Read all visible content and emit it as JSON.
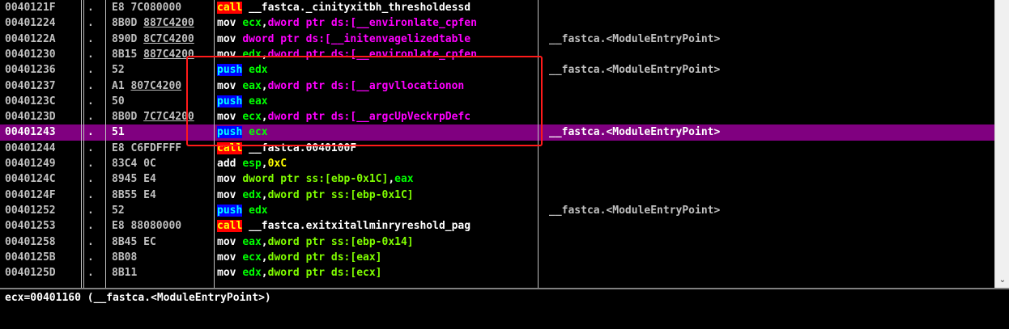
{
  "rows": [
    {
      "addr": "0040121F",
      "mark": ".",
      "hex": "E8 7C080000",
      "hex_ul": "",
      "hex_rest": "",
      "asm": [
        {
          "t": "call",
          "c": "t-call"
        },
        {
          "t": " "
        },
        {
          "t": "__fastca._cinityxitbh_thresholdessd",
          "c": "t-plain"
        }
      ],
      "comment": ""
    },
    {
      "addr": "00401224",
      "mark": ".",
      "hex": "",
      "hex_pre": "8B0D ",
      "hex_ul": "887C4200",
      "asm": [
        {
          "t": "mov",
          "c": "t-mov"
        },
        {
          "t": " "
        },
        {
          "t": "ecx",
          "c": "t-reg"
        },
        {
          "t": ",",
          "c": "t-op"
        },
        {
          "t": "dword ptr ds:[",
          "c": "t-ptr"
        },
        {
          "t": "__environlate_cpfen",
          "c": "t-dsym"
        }
      ],
      "comment": ""
    },
    {
      "addr": "0040122A",
      "mark": ".",
      "hex": "",
      "hex_pre": "890D ",
      "hex_ul": "8C7C4200",
      "asm": [
        {
          "t": "mov",
          "c": "t-mov"
        },
        {
          "t": " "
        },
        {
          "t": "dword ptr ds:[",
          "c": "t-ptr"
        },
        {
          "t": "__initenvagelizedtable",
          "c": "t-dsym"
        }
      ],
      "comment": "__fastca.<ModuleEntryPoint>"
    },
    {
      "addr": "00401230",
      "mark": ".",
      "hex": "",
      "hex_pre": "8B15 ",
      "hex_ul": "887C4200",
      "asm": [
        {
          "t": "mov",
          "c": "t-mov"
        },
        {
          "t": " "
        },
        {
          "t": "edx",
          "c": "t-reg"
        },
        {
          "t": ",",
          "c": "t-op"
        },
        {
          "t": "dword ptr ds:[",
          "c": "t-ptr"
        },
        {
          "t": "__environlate_cpfen",
          "c": "t-dsym"
        }
      ],
      "comment": ""
    },
    {
      "addr": "00401236",
      "mark": ".",
      "hex": "52",
      "asm": [
        {
          "t": "push",
          "c": "t-push"
        },
        {
          "t": " "
        },
        {
          "t": "edx",
          "c": "t-reg"
        }
      ],
      "comment": "__fastca.<ModuleEntryPoint>"
    },
    {
      "addr": "00401237",
      "mark": ".",
      "hex": "",
      "hex_pre": "A1 ",
      "hex_ul": "807C4200",
      "asm": [
        {
          "t": "mov",
          "c": "t-mov"
        },
        {
          "t": " "
        },
        {
          "t": "eax",
          "c": "t-reg"
        },
        {
          "t": ",",
          "c": "t-op"
        },
        {
          "t": "dword ptr ds:[",
          "c": "t-ptr"
        },
        {
          "t": "__argvllocationon",
          "c": "t-dsym"
        }
      ],
      "comment": ""
    },
    {
      "addr": "0040123C",
      "mark": ".",
      "hex": "50",
      "asm": [
        {
          "t": "push",
          "c": "t-push"
        },
        {
          "t": " "
        },
        {
          "t": "eax",
          "c": "t-reg"
        }
      ],
      "comment": ""
    },
    {
      "addr": "0040123D",
      "mark": ".",
      "hex": "",
      "hex_pre": "8B0D ",
      "hex_ul": "7C7C4200",
      "asm": [
        {
          "t": "mov",
          "c": "t-mov"
        },
        {
          "t": " "
        },
        {
          "t": "ecx",
          "c": "t-reg"
        },
        {
          "t": ",",
          "c": "t-op"
        },
        {
          "t": "dword ptr ds:[",
          "c": "t-ptr"
        },
        {
          "t": "__argcUpVeckrpDefc",
          "c": "t-dsym"
        }
      ],
      "comment": ""
    },
    {
      "addr": "00401243",
      "mark": ".",
      "hex": "51",
      "sel": true,
      "asm": [
        {
          "t": "push",
          "c": "t-push"
        },
        {
          "t": " "
        },
        {
          "t": "ecx",
          "c": "t-reg"
        }
      ],
      "comment": "__fastca.<ModuleEntryPoint>"
    },
    {
      "addr": "00401244",
      "mark": ".",
      "hex": "E8 C6FDFFFF",
      "asm": [
        {
          "t": "call",
          "c": "t-call"
        },
        {
          "t": " "
        },
        {
          "t": "__fastca.0040100F",
          "c": "t-plain"
        }
      ],
      "comment": ""
    },
    {
      "addr": "00401249",
      "mark": ".",
      "hex": "83C4 0C",
      "asm": [
        {
          "t": "add",
          "c": "t-add"
        },
        {
          "t": " "
        },
        {
          "t": "esp",
          "c": "t-reg"
        },
        {
          "t": ",",
          "c": "t-op"
        },
        {
          "t": "0xC",
          "c": "t-num"
        }
      ],
      "comment": ""
    },
    {
      "addr": "0040124C",
      "mark": ".",
      "hex": "8945 E4",
      "asm": [
        {
          "t": "mov",
          "c": "t-mov"
        },
        {
          "t": " "
        },
        {
          "t": "dword ptr ss:[ebp-0x1C]",
          "c": "t-imm"
        },
        {
          "t": ",",
          "c": "t-op"
        },
        {
          "t": "eax",
          "c": "t-reg"
        }
      ],
      "comment": ""
    },
    {
      "addr": "0040124F",
      "mark": ".",
      "hex": "8B55 E4",
      "asm": [
        {
          "t": "mov",
          "c": "t-mov"
        },
        {
          "t": " "
        },
        {
          "t": "edx",
          "c": "t-reg"
        },
        {
          "t": ",",
          "c": "t-op"
        },
        {
          "t": "dword ptr ss:[ebp-0x1C]",
          "c": "t-imm"
        }
      ],
      "comment": ""
    },
    {
      "addr": "00401252",
      "mark": ".",
      "hex": "52",
      "asm": [
        {
          "t": "push",
          "c": "t-push"
        },
        {
          "t": " "
        },
        {
          "t": "edx",
          "c": "t-reg"
        }
      ],
      "comment": "__fastca.<ModuleEntryPoint>"
    },
    {
      "addr": "00401253",
      "mark": ".",
      "hex": "E8 88080000",
      "asm": [
        {
          "t": "call",
          "c": "t-call"
        },
        {
          "t": " "
        },
        {
          "t": "__fastca.exitxitallminryreshold_pag",
          "c": "t-plain"
        }
      ],
      "comment": ""
    },
    {
      "addr": "00401258",
      "mark": ".",
      "hex": "8B45 EC",
      "asm": [
        {
          "t": "mov",
          "c": "t-mov"
        },
        {
          "t": " "
        },
        {
          "t": "eax",
          "c": "t-reg"
        },
        {
          "t": ",",
          "c": "t-op"
        },
        {
          "t": "dword ptr ss:[ebp-0x14]",
          "c": "t-imm"
        }
      ],
      "comment": ""
    },
    {
      "addr": "0040125B",
      "mark": ".",
      "hex": "8B08",
      "asm": [
        {
          "t": "mov",
          "c": "t-mov"
        },
        {
          "t": " "
        },
        {
          "t": "ecx",
          "c": "t-reg"
        },
        {
          "t": ",",
          "c": "t-op"
        },
        {
          "t": "dword ptr ds:[eax]",
          "c": "t-imm"
        }
      ],
      "comment": ""
    },
    {
      "addr": "0040125D",
      "mark": ".",
      "hex": "8B11",
      "asm": [
        {
          "t": "mov",
          "c": "t-mov"
        },
        {
          "t": " "
        },
        {
          "t": "edx",
          "c": "t-reg"
        },
        {
          "t": ",",
          "c": "t-op"
        },
        {
          "t": "dword ptr ds:[ecx]",
          "c": "t-imm"
        }
      ],
      "comment": ""
    }
  ],
  "info_text": "ecx=00401160 (__fastca.<ModuleEntryPoint>)",
  "scroll_arrow": "chevron-down-icon",
  "colors": {
    "selection": "#800080",
    "highlight": "#ff1a1a",
    "call_bg": "#ff0000",
    "push_bg": "#0000ff"
  }
}
